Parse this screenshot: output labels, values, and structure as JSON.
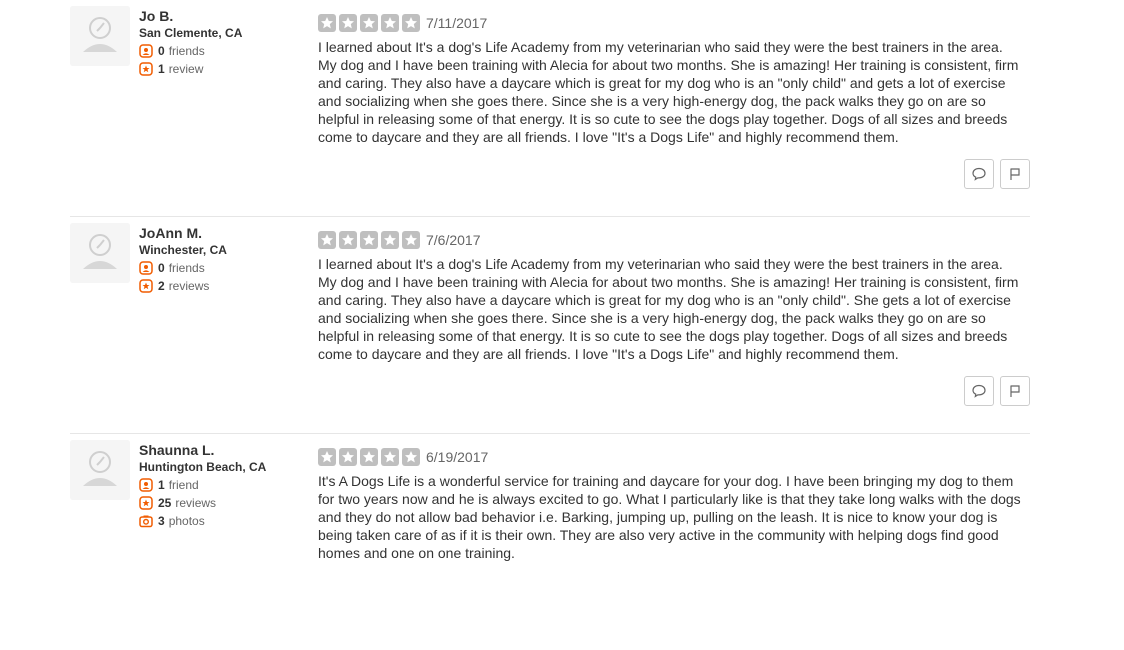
{
  "reviews": [
    {
      "name": "Jo B.",
      "location": "San Clemente, CA",
      "friends_count": "0",
      "friends_label": "friends",
      "reviews_count": "1",
      "reviews_label": "review",
      "rating": 5,
      "date": "7/11/2017",
      "text": "I learned about It's a dog's Life Academy from my veterinarian who said they were the best trainers in the area.  My dog and I have been training with Alecia for about two months.  She  is amazing!  Her training is consistent, firm and caring.  They  also have a daycare which is great for my dog who is an \"only child\" and gets a lot of exercise and socializing when she goes there.  Since she is a very high-energy dog, the pack walks they go on are so helpful in releasing some of that energy.  It is so cute to see the dogs play together.  Dogs of all sizes and breeds come to daycare and they are all friends.  I love \"It's a Dogs Life\" and highly recommend them."
    },
    {
      "name": "JoAnn M.",
      "location": "Winchester, CA",
      "friends_count": "0",
      "friends_label": "friends",
      "reviews_count": "2",
      "reviews_label": "reviews",
      "rating": 5,
      "date": "7/6/2017",
      "text": "I learned about It's a dog's Life Academy from my veterinarian who said they were the best trainers in the area.  My dog and I have been training with Alecia for about two months.  She  is amazing!  Her training is consistent, firm and caring.  They  also have a daycare which is great for my dog who is an \"only child\".  She gets a lot of exercise and socializing when she goes there.  Since she is a very high-energy dog, the pack walks they go on are so helpful in releasing some of that energy.  It is so cute to see the dogs play together.  Dogs of all sizes and breeds come to daycare and they are all friends.  I love \"It's a Dogs Life\" and highly recommend them."
    },
    {
      "name": "Shaunna L.",
      "location": "Huntington Beach, CA",
      "friends_count": "1",
      "friends_label": "friend",
      "reviews_count": "25",
      "reviews_label": "reviews",
      "photos_count": "3",
      "photos_label": "photos",
      "rating": 5,
      "date": "6/19/2017",
      "text": "It's A Dogs Life is a wonderful service for training and daycare for your dog. I have been bringing my dog to them for two years now and he is always excited to go. What I particularly like is that they take long walks with the dogs and they do not allow bad behavior i.e. Barking, jumping up, pulling on the leash. It is nice to know your dog is being taken care of as if it is their own. They are also very active in the community with helping dogs find good homes and one on one training."
    }
  ],
  "icons": {
    "avatar": "default-user-avatar-icon",
    "friends": "friends-icon",
    "reviews": "review-star-icon",
    "photos": "camera-icon",
    "star": "star-icon",
    "comment": "comment-icon",
    "flag": "flag-icon"
  },
  "colors": {
    "stat_icon_orange": "#f15c00",
    "empty_star_gray": "#bfbfbf",
    "divider": "#e6e6e6"
  }
}
